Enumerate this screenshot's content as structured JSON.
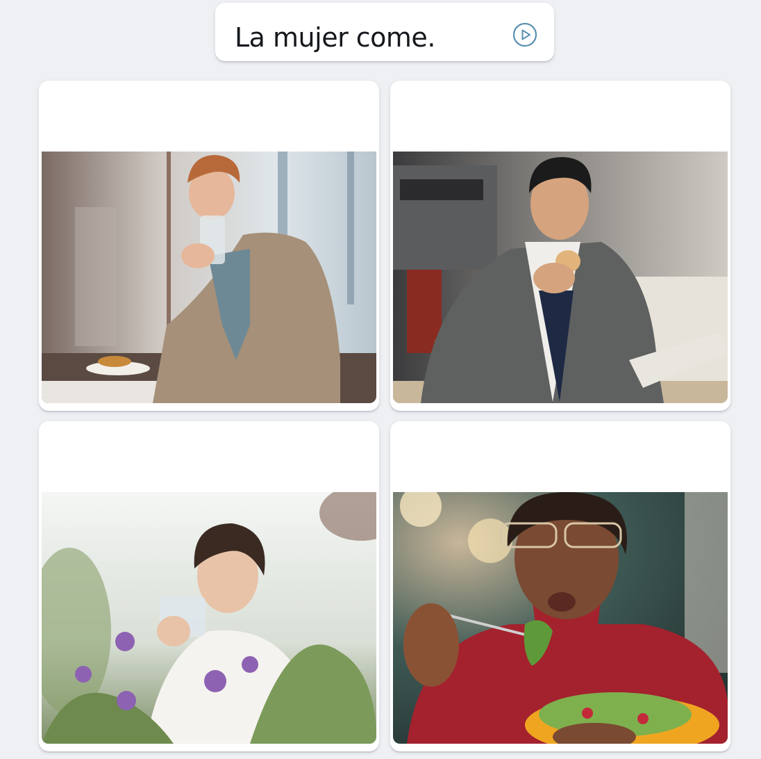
{
  "prompt": {
    "text": "La mujer come."
  },
  "play_icon": "play-circle-icon",
  "cards": [
    {
      "image": "man-drinking-water-photo"
    },
    {
      "image": "man-eating-bread-photo"
    },
    {
      "image": "woman-drinking-water-photo"
    },
    {
      "image": "woman-eating-salad-photo"
    }
  ],
  "colors": {
    "background": "#eef0f4",
    "card": "#ffffff",
    "accent": "#5a8fb0",
    "text": "#15181c"
  }
}
